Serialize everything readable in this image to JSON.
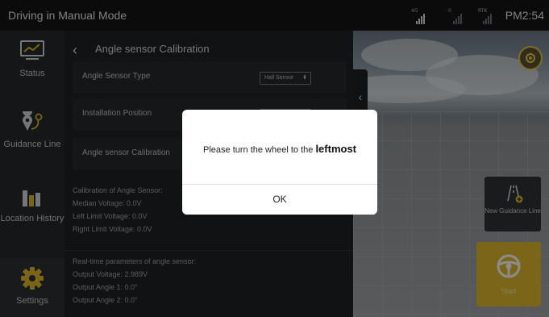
{
  "topbar": {
    "title": "Driving in Manual Mode",
    "signal_4g": "4G",
    "signal_sat": "0",
    "signal_rtk": "RTK",
    "time": "PM2:54"
  },
  "nav": {
    "items": [
      {
        "label": "Status",
        "icon": "status-monitor-icon"
      },
      {
        "label": "Guidance Line",
        "icon": "guidance-pin-icon"
      },
      {
        "label": "Location History",
        "icon": "bar-chart-icon"
      },
      {
        "label": "Settings",
        "icon": "gear-icon"
      }
    ]
  },
  "panel": {
    "heading": "Angle sensor Calibration",
    "rows": [
      {
        "label": "Angle Sensor Type",
        "value": "Hall Sensor"
      },
      {
        "label": "Installation Position",
        "value": ""
      },
      {
        "label": "Angle sensor Calibration"
      }
    ],
    "calibration_info": [
      "Calibration of Angle Sensor:",
      "Median Voltage: 0.0V",
      "Left Limit Voltage: 0.0V",
      "Right Limit Voltage: 0.0V"
    ],
    "realtime_info": [
      "Real-time parameters of angle sensor:",
      "Output Voltage: 2.989V",
      "Output Angle 1: 0.0°",
      "Output Angle 2: 0.0°"
    ]
  },
  "map": {
    "new_line_label": "New Guidance Line",
    "start_label": "Start"
  },
  "modal": {
    "message_prefix": "Please turn the wheel to the ",
    "message_emphasis": "leftmost",
    "ok_label": "OK"
  },
  "colors": {
    "accent": "#e0b82c",
    "background": "#1b1d20",
    "nav_bg": "#26282c"
  }
}
